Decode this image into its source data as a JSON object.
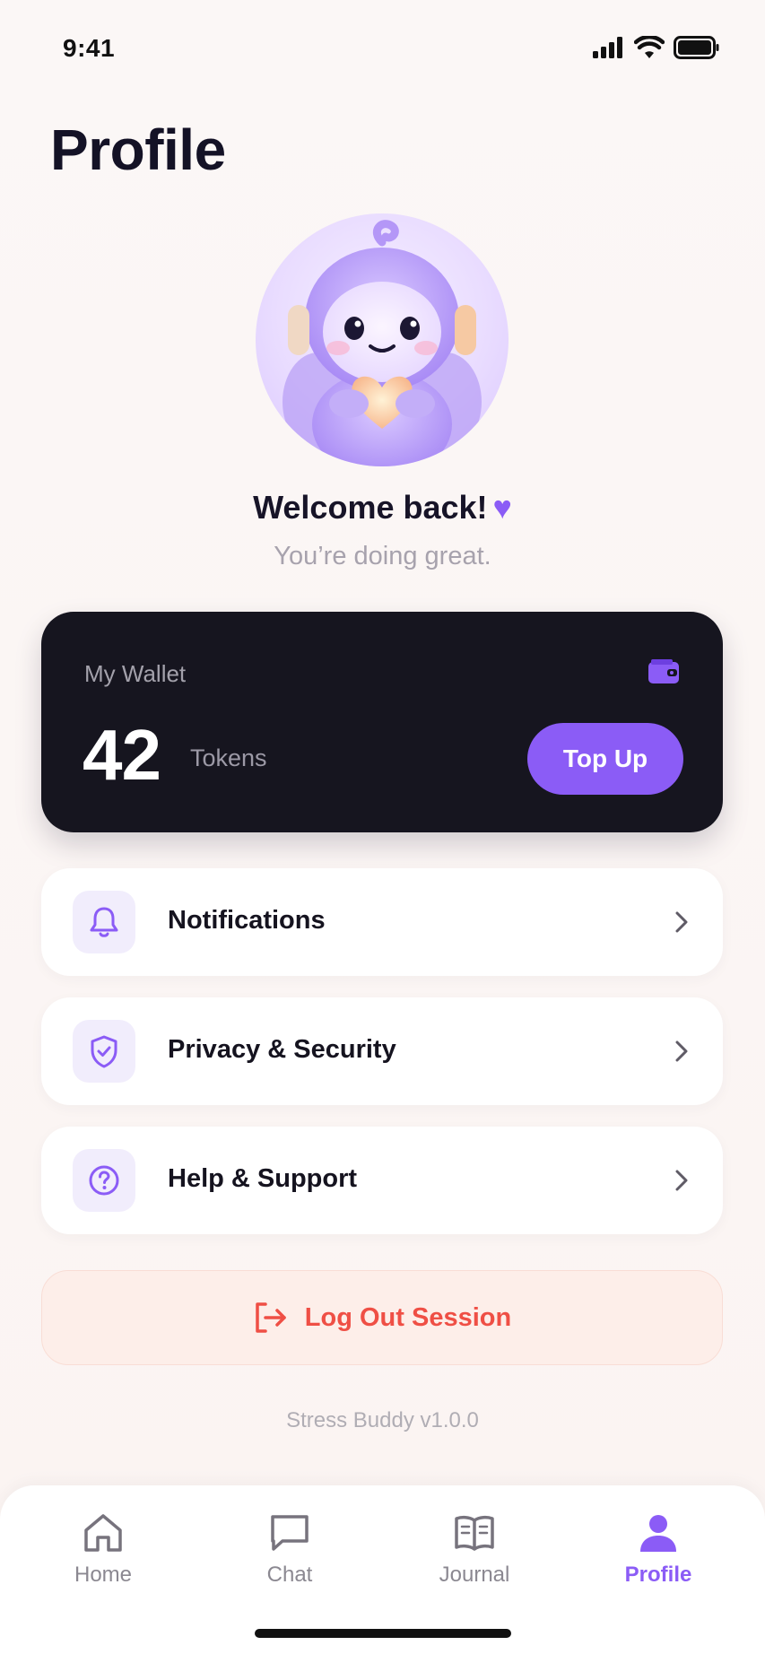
{
  "status": {
    "time": "9:41"
  },
  "page": {
    "title": "Profile"
  },
  "greeting": {
    "title": "Welcome back!",
    "subtitle": "You’re doing great."
  },
  "wallet": {
    "label": "My Wallet",
    "amount": "42",
    "unit": "Tokens",
    "topup_label": "Top Up"
  },
  "menu": [
    {
      "label": "Notifications",
      "icon": "bell-icon"
    },
    {
      "label": "Privacy & Security",
      "icon": "shield-check-icon"
    },
    {
      "label": "Help & Support",
      "icon": "help-circle-icon"
    }
  ],
  "logout": {
    "label": "Log Out Session",
    "icon": "logout-icon"
  },
  "version": "Stress Buddy v1.0.0",
  "tabs": [
    {
      "label": "Home",
      "icon": "home-icon"
    },
    {
      "label": "Chat",
      "icon": "chat-icon"
    },
    {
      "label": "Journal",
      "icon": "journal-icon"
    },
    {
      "label": "Profile",
      "icon": "profile-icon",
      "active": true
    }
  ],
  "colors": {
    "accent": "#8b5cf6",
    "danger": "#ef4f45",
    "card": "#16151f"
  }
}
